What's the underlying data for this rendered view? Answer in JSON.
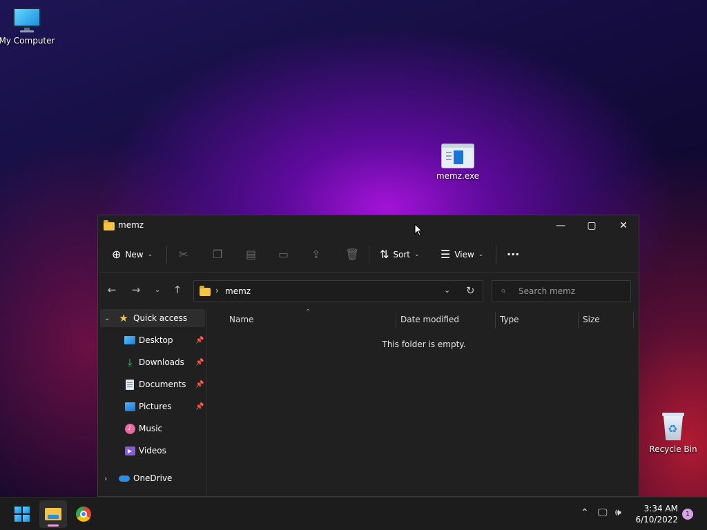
{
  "desktop": {
    "icons": [
      {
        "label": "My Computer",
        "icon": "monitor-icon"
      },
      {
        "label": "memz.exe",
        "icon": "exe-file-icon"
      },
      {
        "label": "Recycle Bin",
        "icon": "recycle-bin-icon"
      }
    ]
  },
  "window": {
    "title": "memz",
    "controls": {
      "minimize": "—",
      "maximize": "▢",
      "close": "✕"
    },
    "command_bar": {
      "new_label": "New",
      "sort_label": "Sort",
      "view_label": "View",
      "more_label": "···"
    },
    "address": {
      "path": "memz",
      "separator": "›"
    },
    "search": {
      "placeholder": "Search memz"
    },
    "navigation_pane": {
      "quick_access": "Quick access",
      "items": [
        {
          "label": "Desktop",
          "pinned": true
        },
        {
          "label": "Downloads",
          "pinned": true
        },
        {
          "label": "Documents",
          "pinned": true
        },
        {
          "label": "Pictures",
          "pinned": true
        },
        {
          "label": "Music",
          "pinned": false
        },
        {
          "label": "Videos",
          "pinned": false
        }
      ],
      "onedrive": "OneDrive"
    },
    "columns": [
      "Name",
      "Date modified",
      "Type",
      "Size"
    ],
    "empty_message": "This folder is empty."
  },
  "taskbar": {
    "clock": {
      "time": "3:34 AM",
      "date": "6/10/2022"
    },
    "notification_count": "1"
  },
  "colors": {
    "window_bg": "#202020",
    "taskbar_bg": "#1c1c1c",
    "folder_yellow": "#f5c446",
    "accent_blue": "#1a8fe6"
  }
}
